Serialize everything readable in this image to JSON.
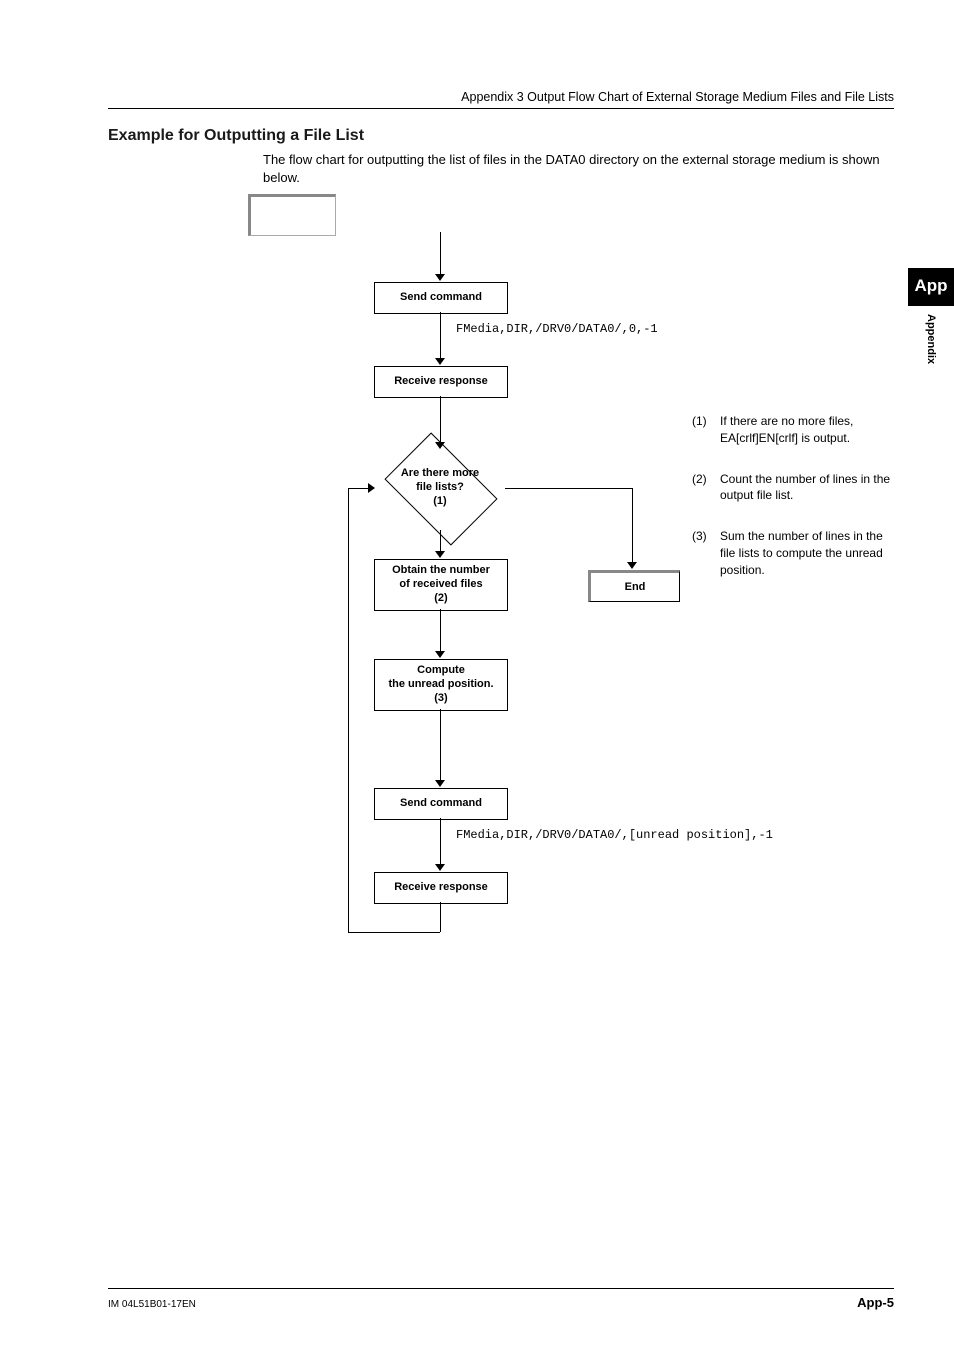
{
  "header": {
    "breadcrumb": "Appendix 3  Output Flow Chart of External Storage Medium Files and File Lists"
  },
  "section": {
    "title": "Example for Outputting a File List",
    "intro": "The flow chart for outputting the list of files in the DATA0 directory on the external storage medium is shown below."
  },
  "flowchart": {
    "send1": "Send command",
    "code1": "FMedia,DIR,/DRV0/DATA0/,0,-1",
    "recv1": "Receive response",
    "decision": "Are there more\nfile lists?\n(1)",
    "obtain": "Obtain the number\nof received files\n(2)",
    "end": "End",
    "compute": "Compute\nthe unread position.\n(3)",
    "send2": "Send command",
    "code2": "FMedia,DIR,/DRV0/DATA0/,[unread position],-1",
    "recv2": "Receive response"
  },
  "notes": [
    {
      "num": "(1)",
      "text": "If there are no more files, EA[crlf]EN[crlf] is output."
    },
    {
      "num": "(2)",
      "text": "Count the number of lines in the output file list."
    },
    {
      "num": "(3)",
      "text": "Sum the number of lines in the file lists to compute the unread position."
    }
  ],
  "sidetab": {
    "badge": "App",
    "label": "Appendix"
  },
  "footer": {
    "left": "IM 04L51B01-17EN",
    "right": "App-5"
  }
}
